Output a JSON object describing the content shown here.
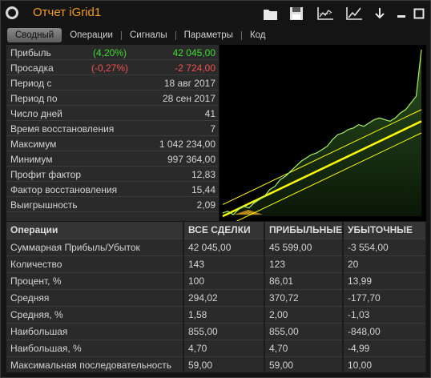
{
  "window": {
    "title": "Отчет iGrid1"
  },
  "toolbar": {
    "icons": [
      "folder-open-icon",
      "save-icon",
      "chart-compare-icon",
      "equity-chart-icon",
      "download-icon",
      "minimize-icon",
      "close-icon"
    ]
  },
  "tabs": [
    {
      "label": "Сводный",
      "active": true
    },
    {
      "label": "Операции"
    },
    {
      "label": "Сигналы"
    },
    {
      "label": "Параметры"
    },
    {
      "label": "Код"
    }
  ],
  "summary": [
    {
      "label": "Прибыль",
      "pct": "(4,20%)",
      "pct_color": "green",
      "value": "42 045,00",
      "value_color": "green"
    },
    {
      "label": "Просадка",
      "pct": "(-0,27%)",
      "pct_color": "red",
      "value": "-2 724,00",
      "value_color": "red"
    },
    {
      "label": "Период с",
      "value": "18 авг 2017"
    },
    {
      "label": "Период по",
      "value": "28 сен 2017"
    },
    {
      "label": "Число дней",
      "value": "41"
    },
    {
      "label": "Время восстановления",
      "value": "7"
    },
    {
      "label": "Максимум",
      "value": "1 042 234,00"
    },
    {
      "label": "Минимум",
      "value": "997 364,00"
    },
    {
      "label": "Профит фактор",
      "value": "12,83"
    },
    {
      "label": "Фактор восстановления",
      "value": "15,44"
    },
    {
      "label": "Выигрышность",
      "value": "2,09"
    }
  ],
  "stats": {
    "headers": [
      "Операции",
      "ВСЕ СДЕЛКИ",
      "ПРИБЫЛЬНЫЕ",
      "УБЫТОЧНЫЕ"
    ],
    "rows": [
      [
        "Суммарная Прибыль/Убыток",
        "42 045,00",
        "45 599,00",
        "-3 554,00"
      ],
      [
        "Количество",
        "143",
        "123",
        "20"
      ],
      [
        "Процент, %",
        "100",
        "86,01",
        "13,99"
      ],
      [
        "Средняя",
        "294,02",
        "370,72",
        "-177,70"
      ],
      [
        "Средняя, %",
        "1,58",
        "2,00",
        "-1,03"
      ],
      [
        "Наибольшая",
        "855,00",
        "855,00",
        "-848,00"
      ],
      [
        "Наибольшая, %",
        "4,70",
        "4,70",
        "-4,99"
      ],
      [
        "Максимальная последовательность",
        "59,00",
        "59,00",
        "10,00"
      ]
    ]
  },
  "colors": {
    "accent": "#f39a1f",
    "profit": "#3fdc2f",
    "loss": "#f05050",
    "trend": "#ffff00",
    "equity": "#a6f26a"
  },
  "chart_data": {
    "type": "area",
    "series": [
      {
        "values": [
          0.02,
          0.03,
          0.01,
          0.04,
          0.06,
          0.05,
          0.08,
          0.1,
          0.12,
          0.16,
          0.18,
          0.22,
          0.24,
          0.27,
          0.3,
          0.33,
          0.35,
          0.37,
          0.38,
          0.4,
          0.42,
          0.46,
          0.49,
          0.5,
          0.52,
          0.53,
          0.55,
          0.54,
          0.56,
          0.58,
          0.59,
          0.58,
          0.57,
          0.59,
          0.62,
          0.64,
          0.68,
          0.72,
          1.0
        ]
      }
    ],
    "trend": {
      "start": 0.0,
      "end": 0.57
    },
    "channel": {
      "upper_offset": 0.07,
      "lower_offset": 0.07
    }
  }
}
